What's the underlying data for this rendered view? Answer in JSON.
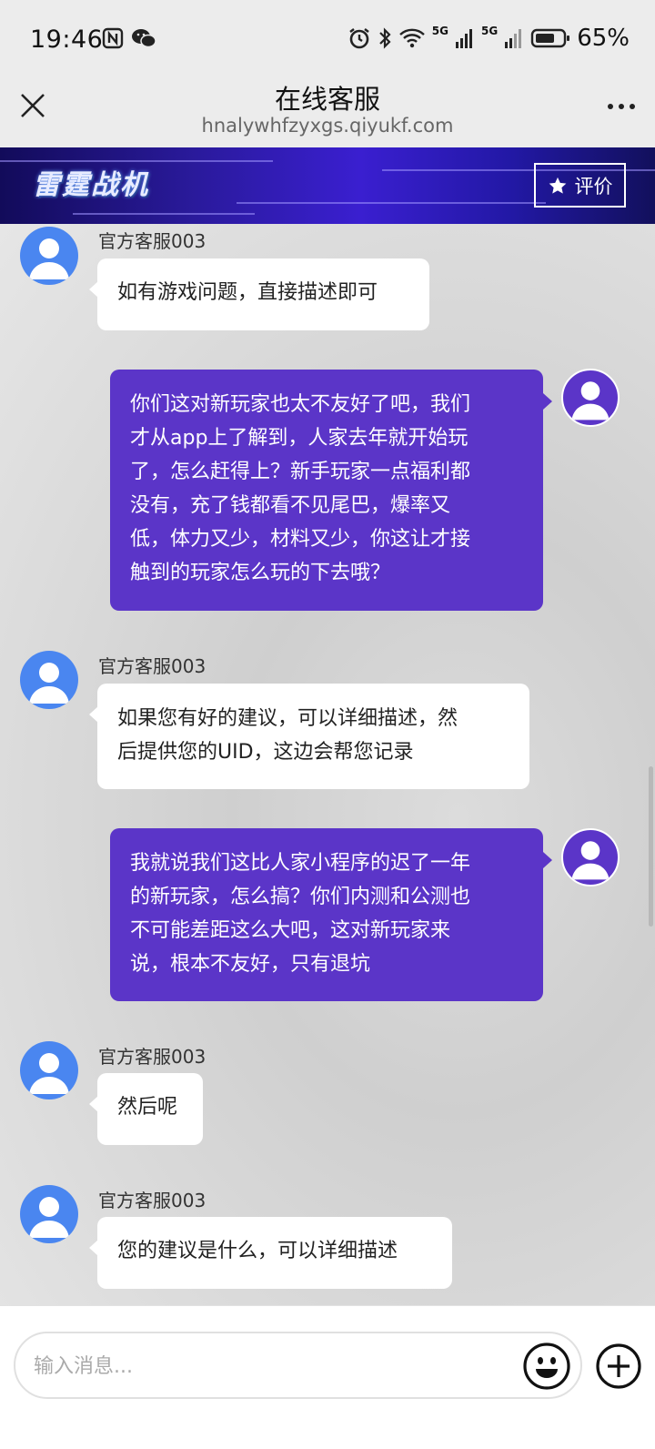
{
  "status": {
    "time": "19:46",
    "network1": "5G",
    "network2": "5G",
    "battery": "65%"
  },
  "nav": {
    "title": "在线客服",
    "url": "hnalywhfzyxgs.qiyukf.com"
  },
  "banner": {
    "logo_text": "雷霆战机",
    "rate_label": "评价"
  },
  "messages": [
    {
      "role": "agent",
      "sender": "官方客服003",
      "text": "如有游戏问题，直接描述即可"
    },
    {
      "role": "user",
      "lines": [
        "你们这对新玩家也太不友好了吧，我们",
        "才从app上了解到，人家去年就开始玩",
        "了，怎么赶得上？新手玩家一点福利都",
        "没有，充了钱都看不见尾巴，爆率又",
        "低，体力又少，材料又少，你这让才接",
        "触到的玩家怎么玩的下去哦？"
      ]
    },
    {
      "role": "agent",
      "sender": "官方客服003",
      "lines": [
        "如果您有好的建议，可以详细描述，然",
        "后提供您的UID，这边会帮您记录"
      ]
    },
    {
      "role": "user",
      "lines": [
        "我就说我们这比人家小程序的迟了一年",
        "的新玩家，怎么搞？你们内测和公测也",
        "不可能差距这么大吧，这对新玩家来",
        "说，根本不友好，只有退坑"
      ]
    },
    {
      "role": "agent",
      "sender": "官方客服003",
      "text": "然后呢"
    },
    {
      "role": "agent",
      "sender": "官方客服003",
      "text": "您的建议是什么，可以详细描述"
    }
  ],
  "input": {
    "placeholder": "输入消息..."
  },
  "colors": {
    "user_bubble": "#5b35c8",
    "agent_avatar": "#4a86f0",
    "banner": "#2a1a9c"
  },
  "icons": [
    "close-icon",
    "more-icon",
    "star-icon",
    "user-avatar-icon",
    "emoji-icon",
    "plus-icon"
  ]
}
